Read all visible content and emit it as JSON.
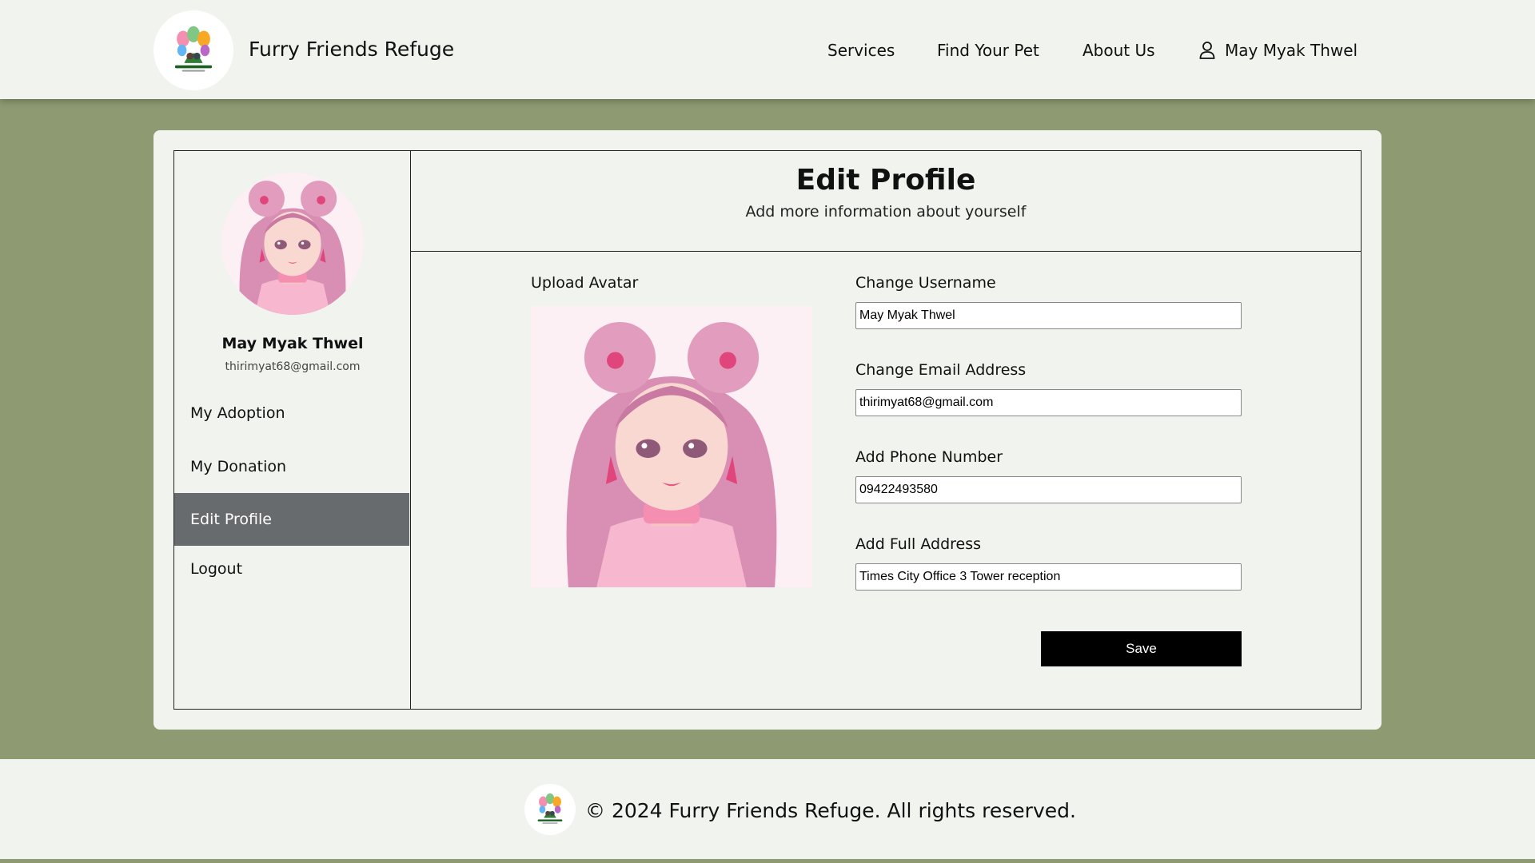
{
  "header": {
    "brand": "Furry Friends Refuge",
    "logo_text": "Furry Friends Refuge",
    "nav": [
      "Services",
      "Find Your Pet",
      "About Us"
    ],
    "user_name": "May Myak Thwel",
    "user_icon": "user-icon"
  },
  "sidebar": {
    "name": "May Myak Thwel",
    "email": "thirimyat68@gmail.com",
    "items": [
      {
        "label": "My Adoption",
        "active": false
      },
      {
        "label": "My Donation",
        "active": false
      },
      {
        "label": "Edit Profile",
        "active": true
      },
      {
        "label": "Logout",
        "active": false
      }
    ]
  },
  "main": {
    "title": "Edit Profile",
    "subtitle": "Add more information about yourself",
    "upload_label": "Upload Avatar",
    "fields": [
      {
        "label": "Change Username",
        "value": "May Myak Thwel"
      },
      {
        "label": "Change Email Address",
        "value": "thirimyat68@gmail.com"
      },
      {
        "label": "Add Phone Number",
        "value": "09422493580"
      },
      {
        "label": "Add Full Address",
        "value": "Times City Office 3 Tower reception"
      }
    ],
    "save_label": "Save"
  },
  "footer": {
    "text": "© 2024 Furry Friends Refuge. All rights reserved."
  },
  "colors": {
    "page_bg": "#8e9a72",
    "panel_bg": "#f1f3ee",
    "active_item": "#686b6e",
    "button": "#000000"
  }
}
